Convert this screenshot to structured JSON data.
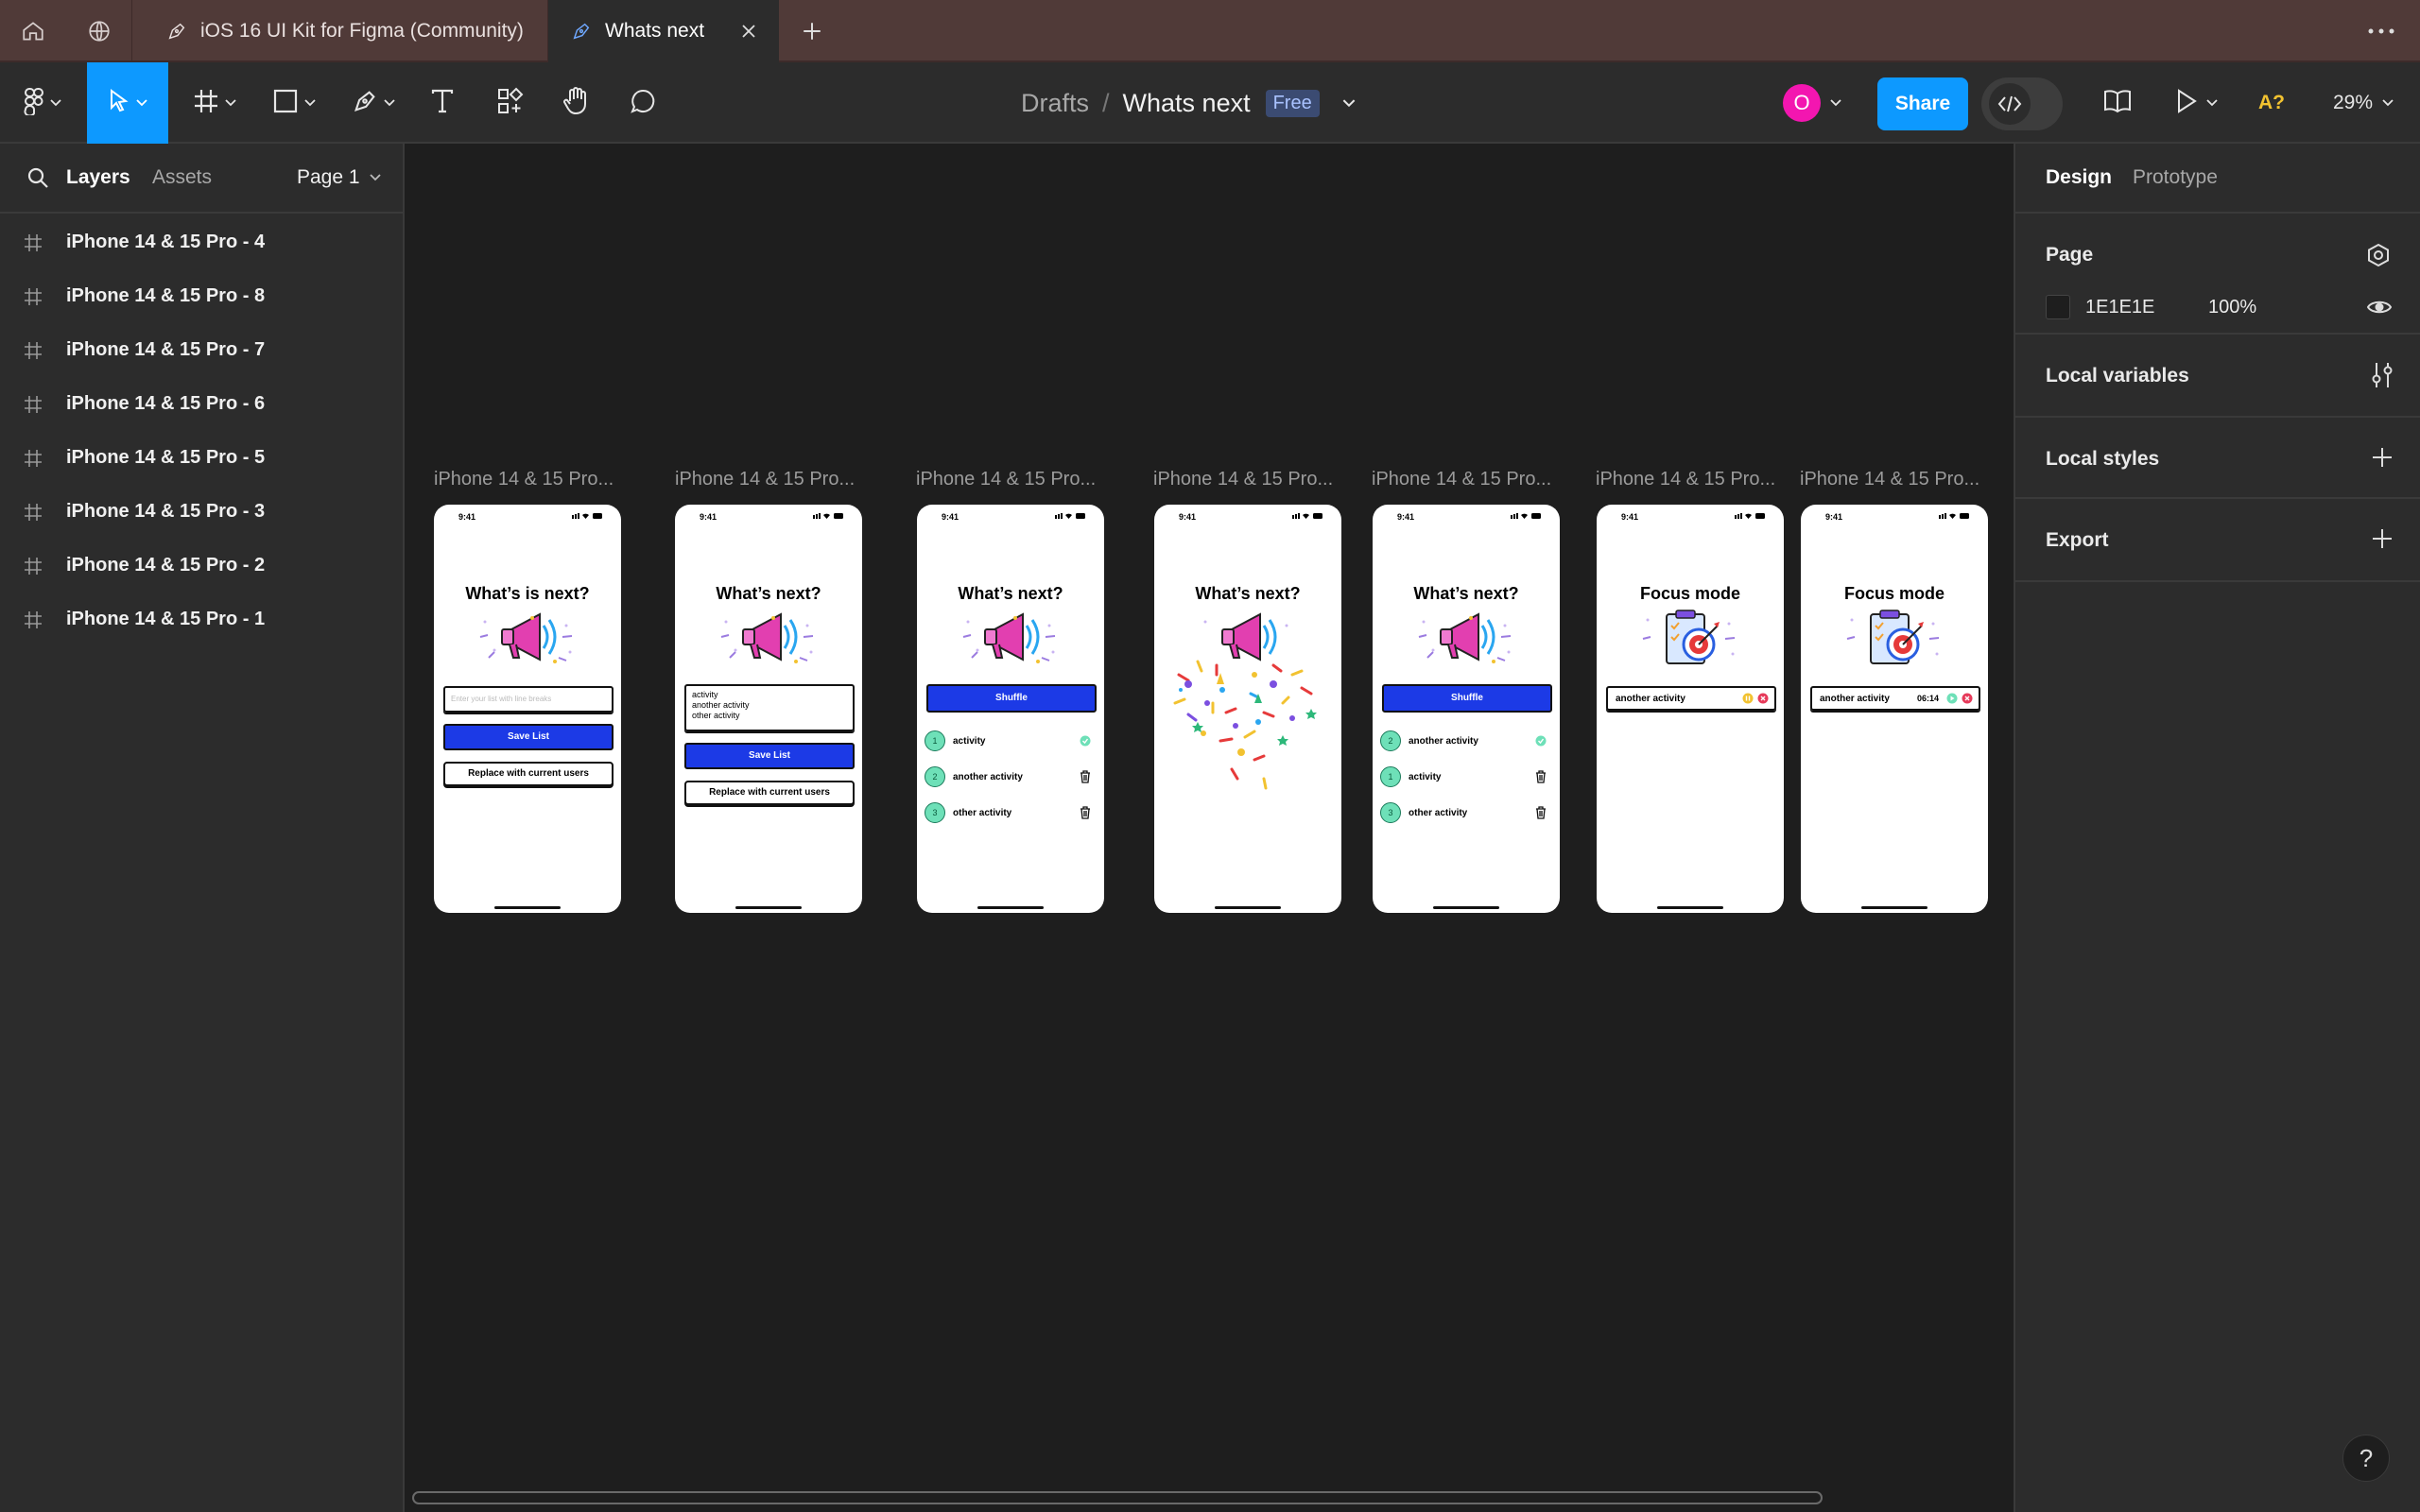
{
  "tabs": [
    {
      "label": "iOS 16 UI Kit for Figma (Community)",
      "active": false
    },
    {
      "label": "Whats next",
      "active": true
    }
  ],
  "toolbar": {
    "breadcrumb_root": "Drafts",
    "separator": "/",
    "file_name": "Whats next",
    "plan_badge": "Free",
    "avatar_letter": "O",
    "share_label": "Share",
    "zoom": "29%",
    "missing_fonts": "A?"
  },
  "left_panel": {
    "tab_layers": "Layers",
    "tab_assets": "Assets",
    "page_selector": "Page 1",
    "layers": [
      "iPhone 14 & 15 Pro - 4",
      "iPhone 14 & 15 Pro - 8",
      "iPhone 14 & 15 Pro - 7",
      "iPhone 14 & 15 Pro - 6",
      "iPhone 14 & 15 Pro - 5",
      "iPhone 14 & 15 Pro - 3",
      "iPhone 14 & 15 Pro - 2",
      "iPhone 14 & 15 Pro - 1"
    ]
  },
  "right_panel": {
    "tab_design": "Design",
    "tab_prototype": "Prototype",
    "page_title": "Page",
    "page_color": "1E1E1E",
    "page_opacity": "100%",
    "local_variables": "Local variables",
    "local_styles": "Local styles",
    "export": "Export"
  },
  "canvas": {
    "frame_label": "iPhone 14 & 15 Pro...",
    "phones": [
      {
        "time": "9:41",
        "title": "What’s is next?",
        "input_placeholder": "Enter your list with line breaks",
        "save": "Save List",
        "replace": "Replace with current users"
      },
      {
        "time": "9:41",
        "title": "What’s next?",
        "textarea_lines": [
          "activity",
          "another activity",
          "other activity"
        ],
        "save": "Save List",
        "replace": "Replace with current users"
      },
      {
        "time": "9:41",
        "title": "What’s next?",
        "shuffle": "Shuffle",
        "items": [
          {
            "n": "1",
            "text": "activity"
          },
          {
            "n": "2",
            "text": "another activity"
          },
          {
            "n": "3",
            "text": "other activity"
          }
        ]
      },
      {
        "time": "9:41",
        "title": "What’s next?"
      },
      {
        "time": "9:41",
        "title": "What’s next?",
        "shuffle": "Shuffle",
        "items": [
          {
            "n": "2",
            "text": "another activity"
          },
          {
            "n": "1",
            "text": "activity"
          },
          {
            "n": "3",
            "text": "other activity"
          }
        ]
      },
      {
        "time": "9:41",
        "title": "Focus mode",
        "focus_item": "another activity"
      },
      {
        "time": "9:41",
        "title": "Focus mode",
        "focus_item": "another activity",
        "timer": "06:14"
      }
    ]
  },
  "colors": {
    "accent": "#0d99ff",
    "app_blue": "#1c3ae6",
    "avatar": "#f316b0",
    "titlebar": "#503a38"
  }
}
